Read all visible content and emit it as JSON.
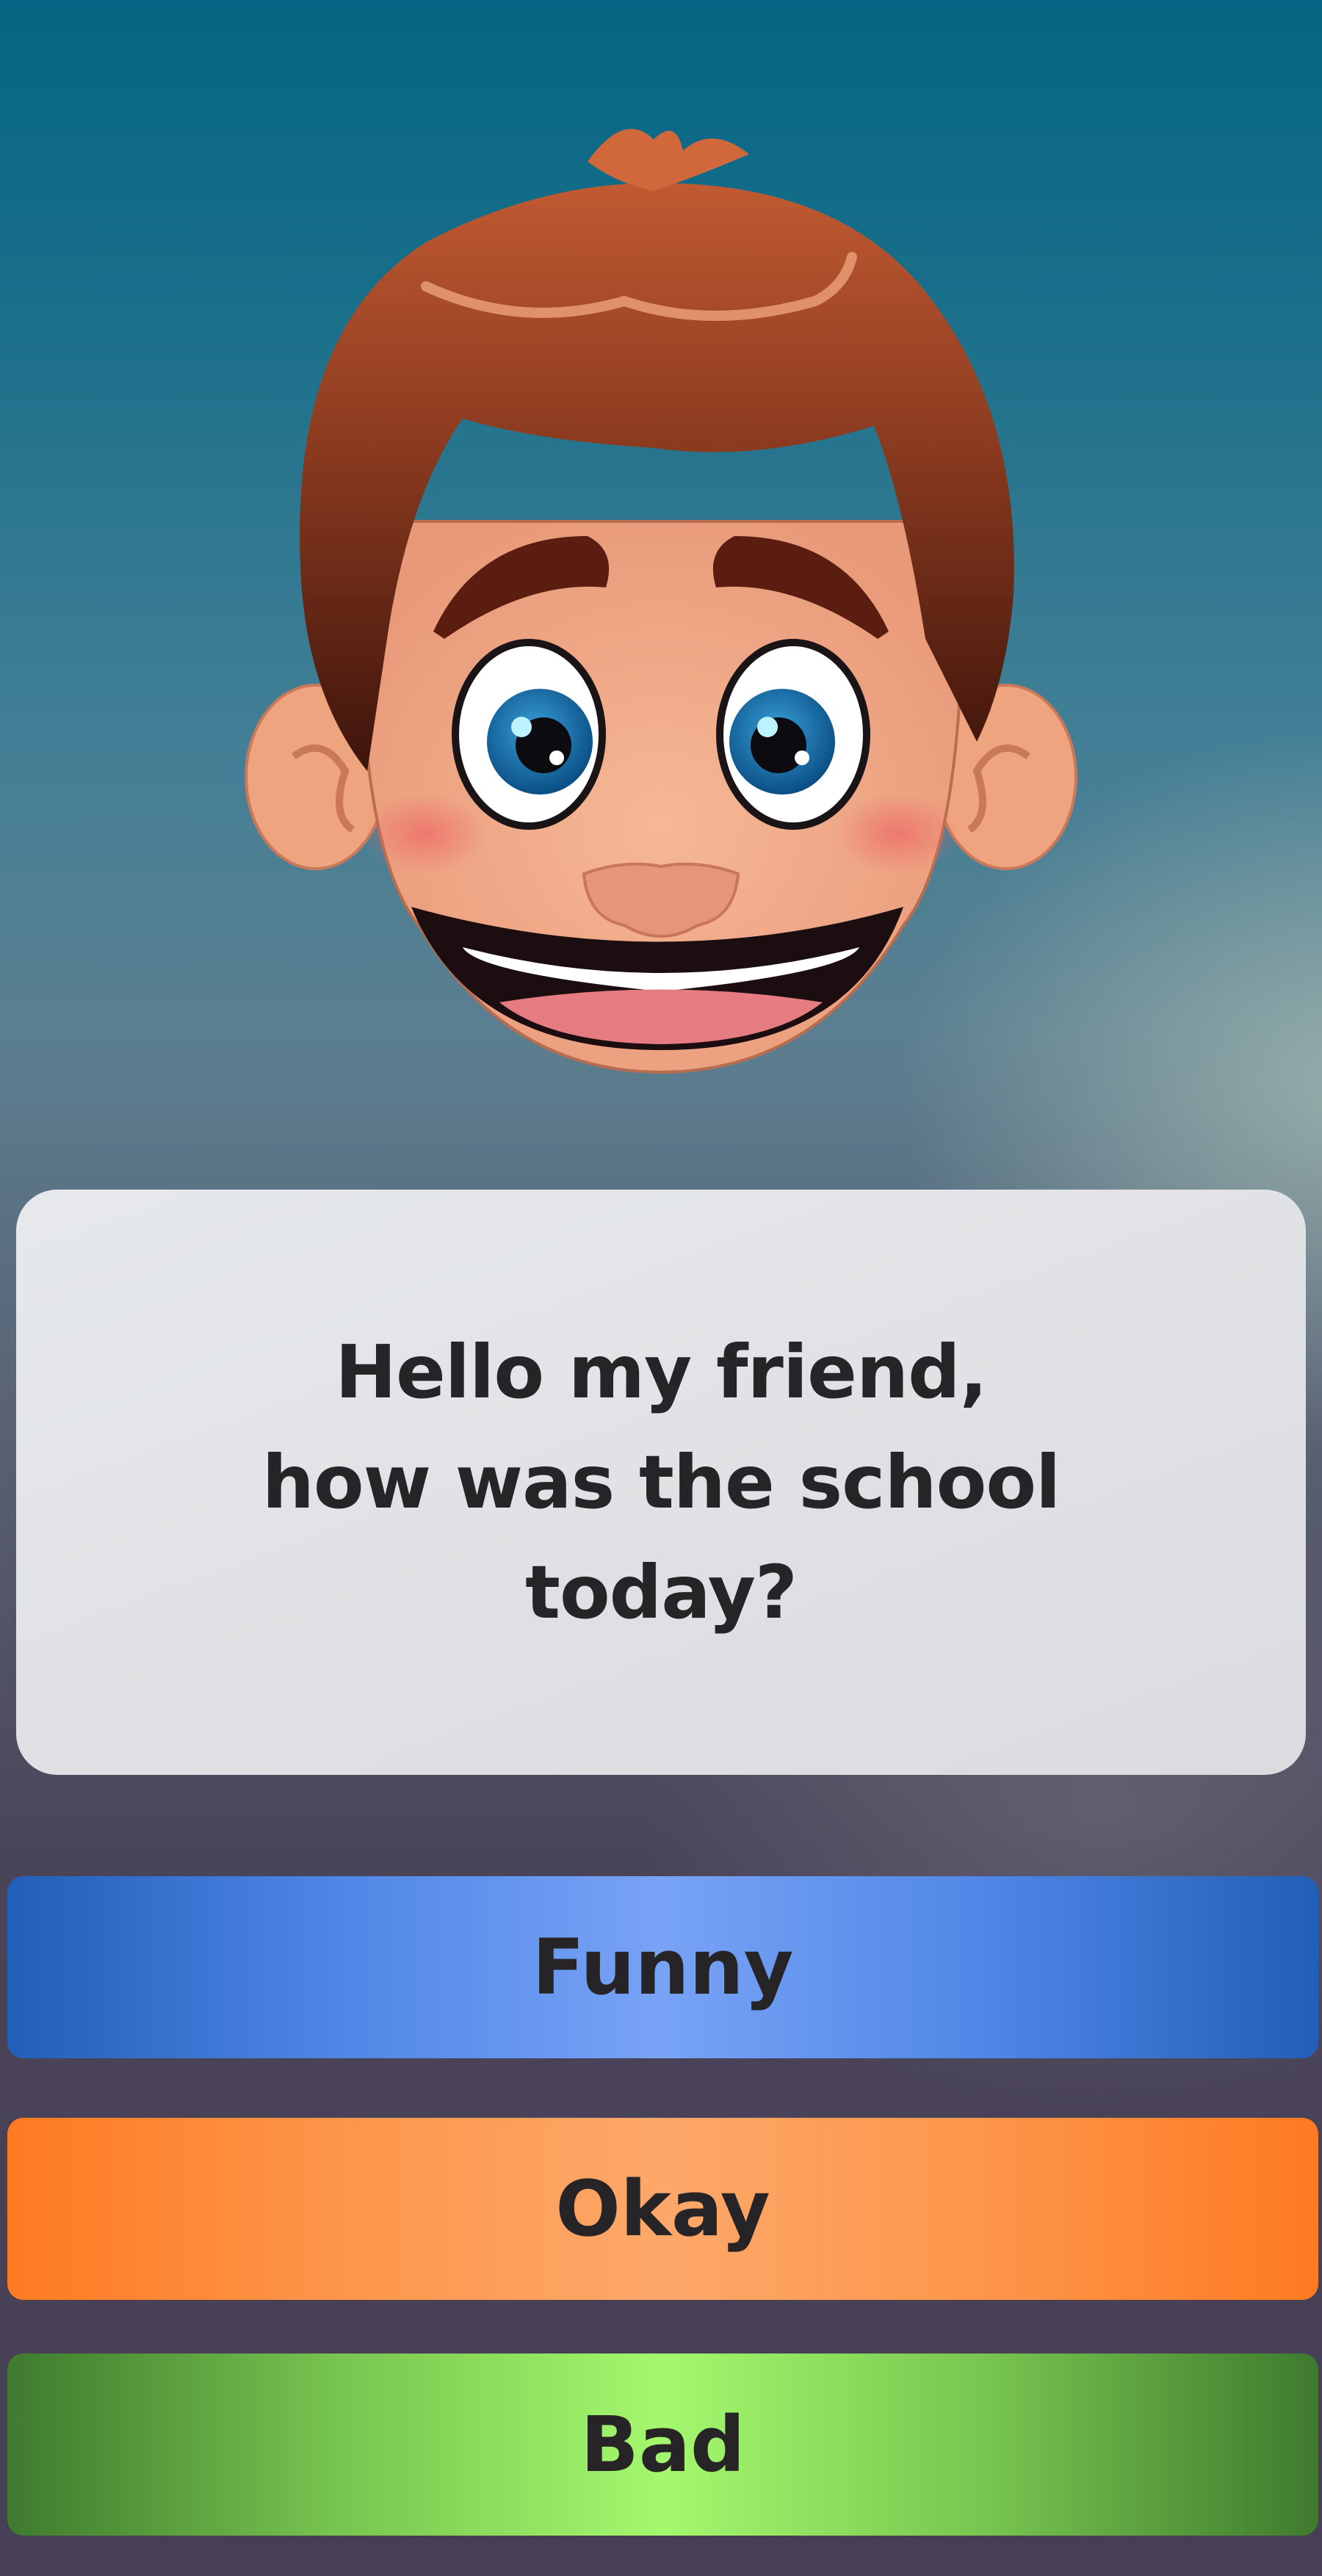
{
  "illustration": {
    "icon": "smiling-boy-face-icon"
  },
  "dialog": {
    "lines": [
      "Hello my friend,",
      "how was the school",
      "today?"
    ]
  },
  "answers": [
    {
      "label": "Funny",
      "color": "#4f86e6"
    },
    {
      "label": "Okay",
      "color": "#fd9549"
    },
    {
      "label": "Bad",
      "color": "#77c44f"
    }
  ]
}
